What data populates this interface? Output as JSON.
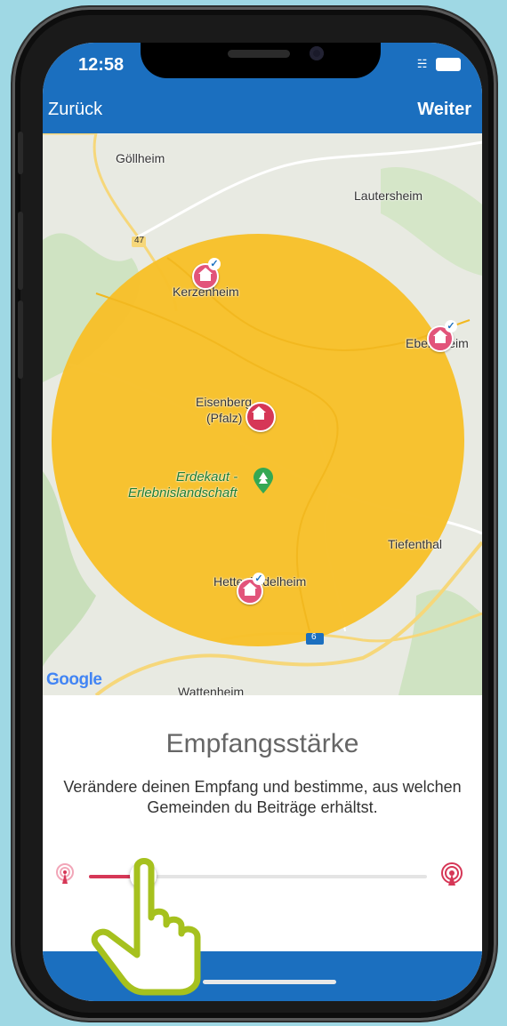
{
  "status_bar": {
    "time": "12:58"
  },
  "nav": {
    "back_label": "Zurück",
    "next_label": "Weiter"
  },
  "map": {
    "places": {
      "goellheim": "Göllheim",
      "lautersheim": "Lautersheim",
      "kerzenheim": "Kerzenheim",
      "ebertsheim": "Ebertsheim",
      "eisenberg_line1": "Eisenberg",
      "eisenberg_line2": "(Pfalz)",
      "erdekaut_line1": "Erdekaut -",
      "erdekaut_line2": "Erlebnislandschaft",
      "tiefenthal": "Tiefenthal",
      "hettenleidelheim": "Hettenleidelheim",
      "wattenheim": "Wattenheim"
    },
    "road_labels": {
      "road_47": "47",
      "road_6": "6"
    },
    "attribution": "Google",
    "radius_color": "#f7c02a"
  },
  "panel": {
    "title": "Empfangsstärke",
    "description": "Verändere deinen Empfang und bestimme, aus welchen Gemeinden du Beiträge erhältst.",
    "slider_value_fraction": 0.16
  },
  "colors": {
    "primary": "#1b6fbf",
    "accent": "#d63757",
    "hand_outline": "#a6c11e"
  }
}
